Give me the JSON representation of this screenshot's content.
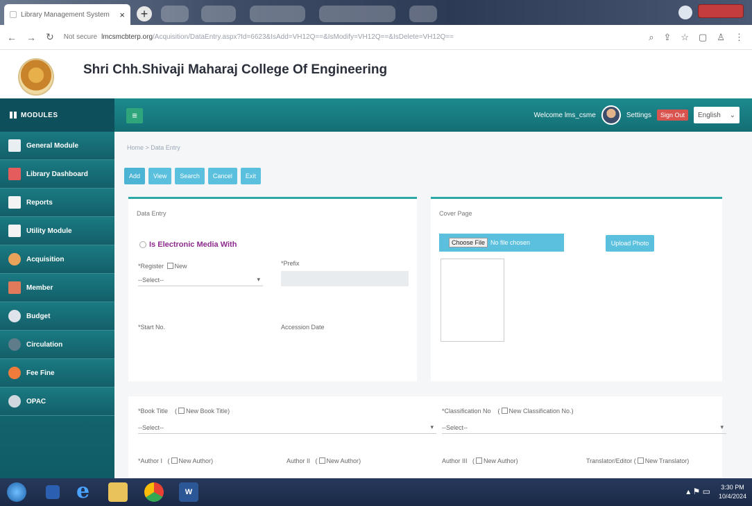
{
  "browser": {
    "tab_title": "Library Management System",
    "tab_close": "×",
    "new_tab": "+",
    "not_secure": "Not secure",
    "url_host": "lmcsmcbterp.org",
    "url_path": "/Acquisition/DataEntry.aspx?Id=6623&IsAdd=VH12Q==&IsModify=VH12Q==&IsDelete=VH12Q=="
  },
  "college": {
    "name": "Shri Chh.Shivaji Maharaj College Of Engineering"
  },
  "topbar": {
    "modules_label": "MODULES",
    "welcome": "Welcome lms_csme",
    "settings": "Settings",
    "sign_out": "Sign Out",
    "language": "English"
  },
  "sidebar": {
    "items": [
      {
        "label": "General Module"
      },
      {
        "label": "Library Dashboard"
      },
      {
        "label": "Reports"
      },
      {
        "label": "Utility Module"
      },
      {
        "label": "Acquisition"
      },
      {
        "label": "Member"
      },
      {
        "label": "Budget"
      },
      {
        "label": "Circulation"
      },
      {
        "label": "Fee Fine"
      },
      {
        "label": "OPAC"
      }
    ]
  },
  "main": {
    "breadcrumb": "Home > Data Entry",
    "actions": [
      "Add",
      "View",
      "Search",
      "Cancel",
      "Exit"
    ],
    "data_entry": {
      "title": "Data Entry",
      "electronic_media": "Is Electronic Media With",
      "register_label": "*Register",
      "new_label": "New",
      "register_value": "--Select--",
      "prefix_label": "*Prefix",
      "start_no_label": "*Start No.",
      "accession_date_label": "Accession Date"
    },
    "cover_page": {
      "title": "Cover Page",
      "choose_file": "Choose File",
      "no_file": "No file chosen",
      "upload": "Upload Photo"
    },
    "book": {
      "book_title_label": "*Book Title",
      "new_book_title": "New Book Title",
      "book_title_value": "--Select--",
      "classification_label": "*Classification No",
      "new_classification": "New Classification No.",
      "classification_value": "--Select--",
      "author1_label": "*Author I",
      "author2_label": "Author II",
      "author3_label": "Author III",
      "new_author": "New Author",
      "translator_label": "Translator/Editor",
      "new_translator": "New Translator"
    }
  },
  "taskbar": {
    "time": "3:30 PM",
    "date": "10/4/2024"
  },
  "colors": {
    "teal": "#1d8a8e",
    "sidebar_dark": "#0f5c66",
    "button_blue": "#5bc0de",
    "sign_out_red": "#d9534f",
    "electronic_purple": "#8e2a8e"
  }
}
